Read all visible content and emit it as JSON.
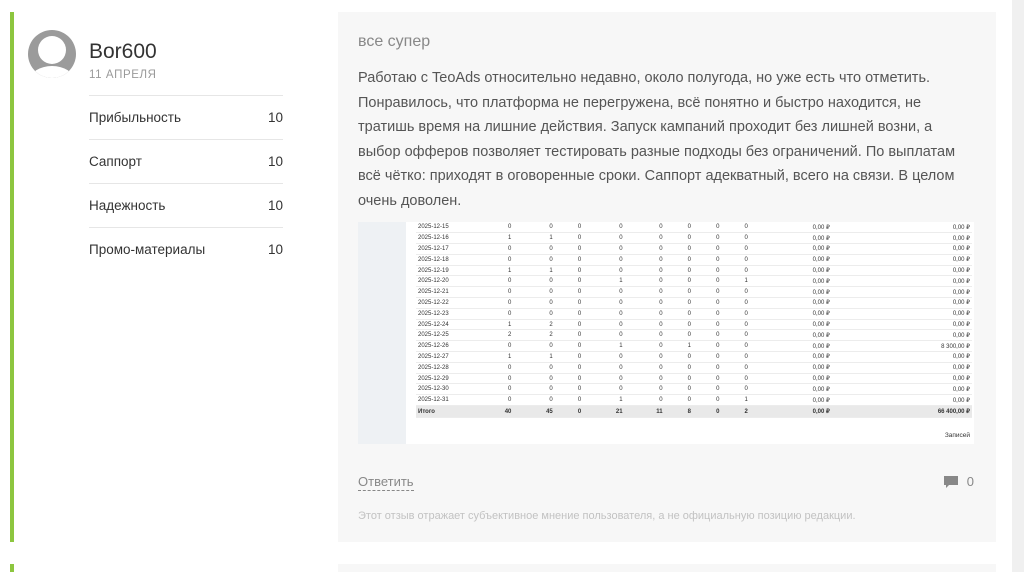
{
  "review": {
    "username": "Bor600",
    "date": "11 АПРЕЛЯ",
    "ratings": [
      {
        "label": "Прибыльность",
        "value": "10"
      },
      {
        "label": "Саппорт",
        "value": "10"
      },
      {
        "label": "Надежность",
        "value": "10"
      },
      {
        "label": "Промо-материалы",
        "value": "10"
      }
    ],
    "title": "все супер",
    "text": "Работаю с TeoAds относительно недавно, около полугода, но уже есть что отметить. Понравилось, что платформа не перегружена, всё понятно и быстро находится, не тратишь время на лишние действия. Запуск кампаний проходит без лишней возни, а выбор офферов позволяет тестировать разные подходы без ограничений. По выплатам всё чётко: приходят в оговоренные сроки. Саппорт адекватный, всего на связи. В целом очень доволен.",
    "reply_label": "Ответить",
    "comment_count": "0",
    "disclaimer": "Этот отзыв отражает субъективное мнение пользователя, а не официальную позицию редакции."
  },
  "screenshot_table": {
    "rows": [
      [
        "2025-12-15",
        "0",
        "0",
        "0",
        "0",
        "0",
        "0",
        "0",
        "0",
        "0,00 ₽",
        "0,00 ₽"
      ],
      [
        "2025-12-16",
        "1",
        "1",
        "0",
        "0",
        "0",
        "0",
        "0",
        "0",
        "0,00 ₽",
        "0,00 ₽"
      ],
      [
        "2025-12-17",
        "0",
        "0",
        "0",
        "0",
        "0",
        "0",
        "0",
        "0",
        "0,00 ₽",
        "0,00 ₽"
      ],
      [
        "2025-12-18",
        "0",
        "0",
        "0",
        "0",
        "0",
        "0",
        "0",
        "0",
        "0,00 ₽",
        "0,00 ₽"
      ],
      [
        "2025-12-19",
        "1",
        "1",
        "0",
        "0",
        "0",
        "0",
        "0",
        "0",
        "0,00 ₽",
        "0,00 ₽"
      ],
      [
        "2025-12-20",
        "0",
        "0",
        "0",
        "1",
        "0",
        "0",
        "0",
        "1",
        "0,00 ₽",
        "0,00 ₽"
      ],
      [
        "2025-12-21",
        "0",
        "0",
        "0",
        "0",
        "0",
        "0",
        "0",
        "0",
        "0,00 ₽",
        "0,00 ₽"
      ],
      [
        "2025-12-22",
        "0",
        "0",
        "0",
        "0",
        "0",
        "0",
        "0",
        "0",
        "0,00 ₽",
        "0,00 ₽"
      ],
      [
        "2025-12-23",
        "0",
        "0",
        "0",
        "0",
        "0",
        "0",
        "0",
        "0",
        "0,00 ₽",
        "0,00 ₽"
      ],
      [
        "2025-12-24",
        "1",
        "2",
        "0",
        "0",
        "0",
        "0",
        "0",
        "0",
        "0,00 ₽",
        "0,00 ₽"
      ],
      [
        "2025-12-25",
        "2",
        "2",
        "0",
        "0",
        "0",
        "0",
        "0",
        "0",
        "0,00 ₽",
        "0,00 ₽"
      ],
      [
        "2025-12-26",
        "0",
        "0",
        "0",
        "1",
        "0",
        "1",
        "0",
        "0",
        "0,00 ₽",
        "8 300,00 ₽"
      ],
      [
        "2025-12-27",
        "1",
        "1",
        "0",
        "0",
        "0",
        "0",
        "0",
        "0",
        "0,00 ₽",
        "0,00 ₽"
      ],
      [
        "2025-12-28",
        "0",
        "0",
        "0",
        "0",
        "0",
        "0",
        "0",
        "0",
        "0,00 ₽",
        "0,00 ₽"
      ],
      [
        "2025-12-29",
        "0",
        "0",
        "0",
        "0",
        "0",
        "0",
        "0",
        "0",
        "0,00 ₽",
        "0,00 ₽"
      ],
      [
        "2025-12-30",
        "0",
        "0",
        "0",
        "0",
        "0",
        "0",
        "0",
        "0",
        "0,00 ₽",
        "0,00 ₽"
      ],
      [
        "2025-12-31",
        "0",
        "0",
        "0",
        "1",
        "0",
        "0",
        "0",
        "1",
        "0,00 ₽",
        "0,00 ₽"
      ]
    ],
    "total": [
      "Итого",
      "40",
      "45",
      "0",
      "21",
      "11",
      "8",
      "0",
      "2",
      "0,00 ₽",
      "66 400,00 ₽"
    ],
    "records_label": "Записей"
  },
  "colors": {
    "accent": "#8dc63f",
    "content_bg": "#f7f7f7"
  },
  "icons": {
    "avatar": "user-silhouette-icon",
    "comments": "speech-bubble-icon"
  }
}
